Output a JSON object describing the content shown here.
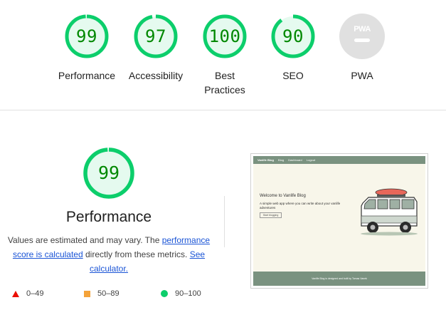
{
  "gauges": [
    {
      "id": "performance",
      "score": "99",
      "label": "Performance",
      "fraction": 0.99
    },
    {
      "id": "accessibility",
      "score": "97",
      "label": "Accessibility",
      "fraction": 0.97
    },
    {
      "id": "best-practices",
      "score": "100",
      "label": "Best\nPractices",
      "fraction": 1.0
    },
    {
      "id": "seo",
      "score": "90",
      "label": "SEO",
      "fraction": 0.9
    },
    {
      "id": "pwa",
      "score": "",
      "label": "PWA",
      "fraction": 0
    }
  ],
  "pwa_badge_text": "PWA",
  "performance_section": {
    "score": "99",
    "fraction": 0.99,
    "title": "Performance",
    "desc_part1": "Values are estimated and may vary. The ",
    "desc_link1": "performance score is calculated",
    "desc_part2": " directly from these metrics. ",
    "desc_link2": "See calculator."
  },
  "legend": [
    {
      "range": "0–49",
      "symbol": "triangle",
      "color": "#eb0f00"
    },
    {
      "range": "50–89",
      "symbol": "square",
      "color": "#f4a33a"
    },
    {
      "range": "90–100",
      "symbol": "circle",
      "color": "#0cce6b"
    }
  ],
  "thumbnail": {
    "nav_brand": "Vanlife Blog",
    "nav_links": [
      "Blog",
      "Dashboard",
      "Logout"
    ],
    "heading": "Welcome to Vanlife Blog",
    "paragraph": "A simple web app where you can write about your vanlife adventures",
    "button": "Start blogging",
    "footer": "Vanlife Blog is designed and built by Tomas Vanek"
  },
  "colors": {
    "pass": "#0cce6b",
    "pass_text": "#008800",
    "pass_bg": "#e5faef",
    "gray": "#e0e0e0"
  }
}
